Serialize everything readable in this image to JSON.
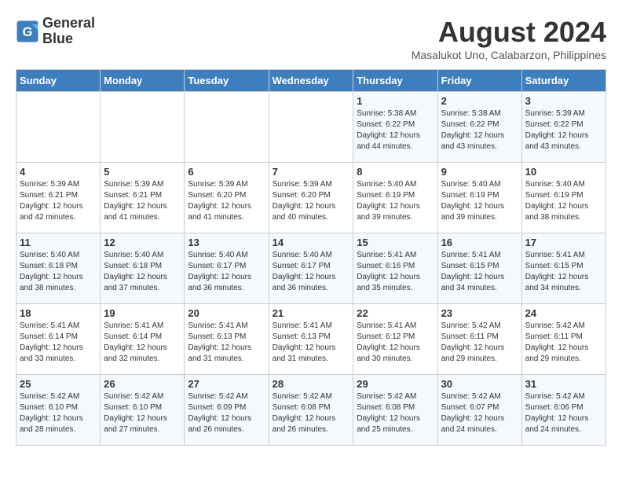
{
  "header": {
    "logo_line1": "General",
    "logo_line2": "Blue",
    "month": "August 2024",
    "location": "Masalukot Uno, Calabarzon, Philippines"
  },
  "weekdays": [
    "Sunday",
    "Monday",
    "Tuesday",
    "Wednesday",
    "Thursday",
    "Friday",
    "Saturday"
  ],
  "weeks": [
    [
      {
        "day": "",
        "info": ""
      },
      {
        "day": "",
        "info": ""
      },
      {
        "day": "",
        "info": ""
      },
      {
        "day": "",
        "info": ""
      },
      {
        "day": "1",
        "info": "Sunrise: 5:38 AM\nSunset: 6:22 PM\nDaylight: 12 hours\nand 44 minutes."
      },
      {
        "day": "2",
        "info": "Sunrise: 5:38 AM\nSunset: 6:22 PM\nDaylight: 12 hours\nand 43 minutes."
      },
      {
        "day": "3",
        "info": "Sunrise: 5:39 AM\nSunset: 6:22 PM\nDaylight: 12 hours\nand 43 minutes."
      }
    ],
    [
      {
        "day": "4",
        "info": "Sunrise: 5:39 AM\nSunset: 6:21 PM\nDaylight: 12 hours\nand 42 minutes."
      },
      {
        "day": "5",
        "info": "Sunrise: 5:39 AM\nSunset: 6:21 PM\nDaylight: 12 hours\nand 41 minutes."
      },
      {
        "day": "6",
        "info": "Sunrise: 5:39 AM\nSunset: 6:20 PM\nDaylight: 12 hours\nand 41 minutes."
      },
      {
        "day": "7",
        "info": "Sunrise: 5:39 AM\nSunset: 6:20 PM\nDaylight: 12 hours\nand 40 minutes."
      },
      {
        "day": "8",
        "info": "Sunrise: 5:40 AM\nSunset: 6:19 PM\nDaylight: 12 hours\nand 39 minutes."
      },
      {
        "day": "9",
        "info": "Sunrise: 5:40 AM\nSunset: 6:19 PM\nDaylight: 12 hours\nand 39 minutes."
      },
      {
        "day": "10",
        "info": "Sunrise: 5:40 AM\nSunset: 6:19 PM\nDaylight: 12 hours\nand 38 minutes."
      }
    ],
    [
      {
        "day": "11",
        "info": "Sunrise: 5:40 AM\nSunset: 6:18 PM\nDaylight: 12 hours\nand 38 minutes."
      },
      {
        "day": "12",
        "info": "Sunrise: 5:40 AM\nSunset: 6:18 PM\nDaylight: 12 hours\nand 37 minutes."
      },
      {
        "day": "13",
        "info": "Sunrise: 5:40 AM\nSunset: 6:17 PM\nDaylight: 12 hours\nand 36 minutes."
      },
      {
        "day": "14",
        "info": "Sunrise: 5:40 AM\nSunset: 6:17 PM\nDaylight: 12 hours\nand 36 minutes."
      },
      {
        "day": "15",
        "info": "Sunrise: 5:41 AM\nSunset: 6:16 PM\nDaylight: 12 hours\nand 35 minutes."
      },
      {
        "day": "16",
        "info": "Sunrise: 5:41 AM\nSunset: 6:15 PM\nDaylight: 12 hours\nand 34 minutes."
      },
      {
        "day": "17",
        "info": "Sunrise: 5:41 AM\nSunset: 6:15 PM\nDaylight: 12 hours\nand 34 minutes."
      }
    ],
    [
      {
        "day": "18",
        "info": "Sunrise: 5:41 AM\nSunset: 6:14 PM\nDaylight: 12 hours\nand 33 minutes."
      },
      {
        "day": "19",
        "info": "Sunrise: 5:41 AM\nSunset: 6:14 PM\nDaylight: 12 hours\nand 32 minutes."
      },
      {
        "day": "20",
        "info": "Sunrise: 5:41 AM\nSunset: 6:13 PM\nDaylight: 12 hours\nand 31 minutes."
      },
      {
        "day": "21",
        "info": "Sunrise: 5:41 AM\nSunset: 6:13 PM\nDaylight: 12 hours\nand 31 minutes."
      },
      {
        "day": "22",
        "info": "Sunrise: 5:41 AM\nSunset: 6:12 PM\nDaylight: 12 hours\nand 30 minutes."
      },
      {
        "day": "23",
        "info": "Sunrise: 5:42 AM\nSunset: 6:11 PM\nDaylight: 12 hours\nand 29 minutes."
      },
      {
        "day": "24",
        "info": "Sunrise: 5:42 AM\nSunset: 6:11 PM\nDaylight: 12 hours\nand 29 minutes."
      }
    ],
    [
      {
        "day": "25",
        "info": "Sunrise: 5:42 AM\nSunset: 6:10 PM\nDaylight: 12 hours\nand 28 minutes."
      },
      {
        "day": "26",
        "info": "Sunrise: 5:42 AM\nSunset: 6:10 PM\nDaylight: 12 hours\nand 27 minutes."
      },
      {
        "day": "27",
        "info": "Sunrise: 5:42 AM\nSunset: 6:09 PM\nDaylight: 12 hours\nand 26 minutes."
      },
      {
        "day": "28",
        "info": "Sunrise: 5:42 AM\nSunset: 6:08 PM\nDaylight: 12 hours\nand 26 minutes."
      },
      {
        "day": "29",
        "info": "Sunrise: 5:42 AM\nSunset: 6:08 PM\nDaylight: 12 hours\nand 25 minutes."
      },
      {
        "day": "30",
        "info": "Sunrise: 5:42 AM\nSunset: 6:07 PM\nDaylight: 12 hours\nand 24 minutes."
      },
      {
        "day": "31",
        "info": "Sunrise: 5:42 AM\nSunset: 6:06 PM\nDaylight: 12 hours\nand 24 minutes."
      }
    ]
  ]
}
